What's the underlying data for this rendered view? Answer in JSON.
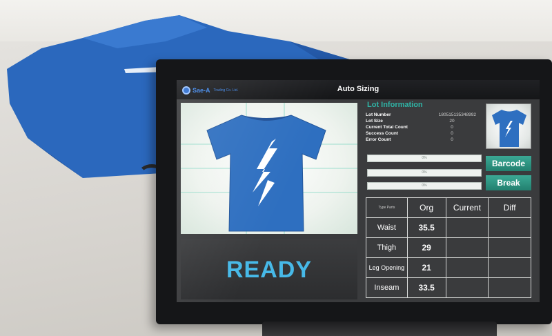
{
  "app": {
    "logo_text": "Sae-A",
    "logo_subtext": "Trading Co. Ltd.",
    "title": "Auto Sizing"
  },
  "colors": {
    "accent": "#2fb5a7",
    "status_text": "#47b9e8",
    "button": "#2a9583",
    "shirt": "#2e6fc0"
  },
  "lot_info": {
    "header": "Lot Information",
    "rows": [
      {
        "label": "Lot Number",
        "value": "180515135348992"
      },
      {
        "label": "Lot Size",
        "value": "20"
      },
      {
        "label": "Current Total Count",
        "value": "0"
      },
      {
        "label": "Success Count",
        "value": "0"
      },
      {
        "label": "Error Count",
        "value": "0"
      }
    ]
  },
  "progress_bars": [
    {
      "label": "0%",
      "value": 0
    },
    {
      "label": "0%",
      "value": 0
    },
    {
      "label": "0%",
      "value": 0
    }
  ],
  "buttons": {
    "barcode": "Barcode",
    "break": "Break"
  },
  "status": "READY",
  "measurements": {
    "headers": {
      "corner": "Type  Parts",
      "org": "Org",
      "current": "Current",
      "diff": "Diff"
    },
    "rows": [
      {
        "part": "Waist",
        "org": "35.5",
        "current": "",
        "diff": ""
      },
      {
        "part": "Thigh",
        "org": "29",
        "current": "",
        "diff": ""
      },
      {
        "part": "Leg Opening",
        "org": "21",
        "current": "",
        "diff": ""
      },
      {
        "part": "Inseam",
        "org": "33.5",
        "current": "",
        "diff": ""
      }
    ]
  },
  "icons": {
    "logo": "sae-a-logo-icon",
    "shirt_preview": "tshirt-lightning-icon",
    "thumbnail": "tshirt-thumbnail-icon"
  }
}
